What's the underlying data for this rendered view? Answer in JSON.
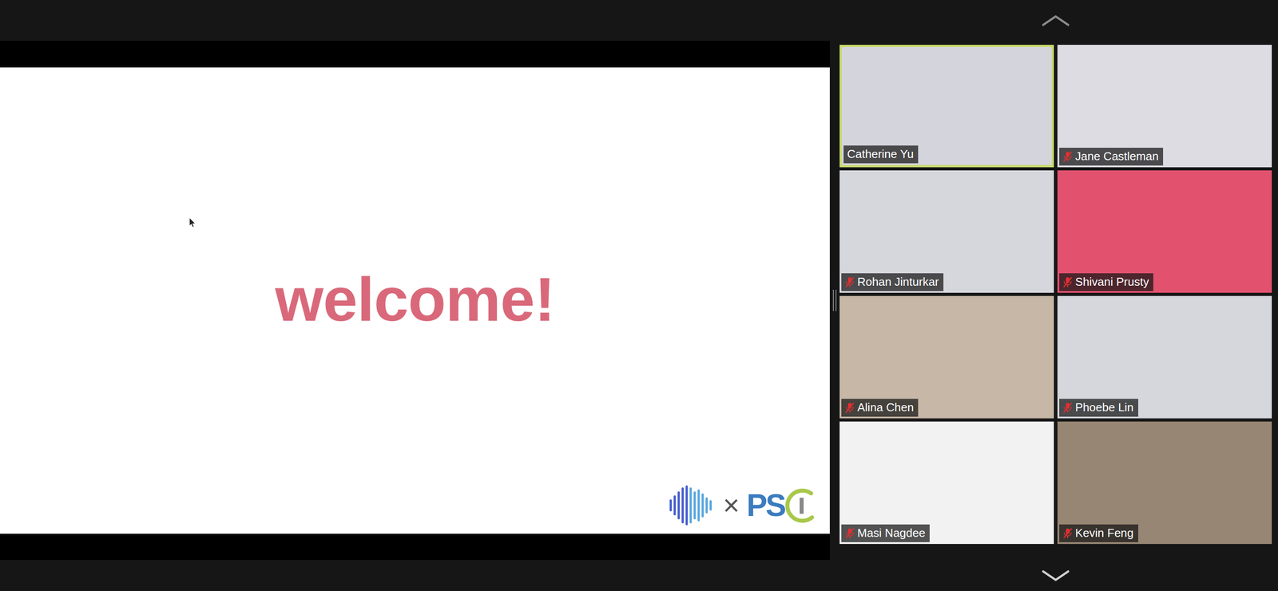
{
  "slide": {
    "heading": "welcome!",
    "logo": {
      "times": "×",
      "letters": "PS"
    }
  },
  "participants": [
    {
      "name": "Catherine Yu",
      "muted": false,
      "selected": true,
      "color": "#d4d5dc"
    },
    {
      "name": "Jane Castleman",
      "muted": true,
      "selected": false,
      "color": "#dcdce2"
    },
    {
      "name": "Rohan Jinturkar",
      "muted": true,
      "selected": false,
      "color": "#d6d7dd"
    },
    {
      "name": "Shivani Prusty",
      "muted": true,
      "selected": false,
      "color": "#e2526f"
    },
    {
      "name": "Alina Chen",
      "muted": true,
      "selected": false,
      "color": "#c7b7a6"
    },
    {
      "name": "Phoebe Lin",
      "muted": true,
      "selected": false,
      "color": "#d5d7dd"
    },
    {
      "name": "Masi Nagdee",
      "muted": true,
      "selected": false,
      "color": "#f2f2f2"
    },
    {
      "name": "Kevin Feng",
      "muted": true,
      "selected": false,
      "color": "#978673"
    }
  ]
}
